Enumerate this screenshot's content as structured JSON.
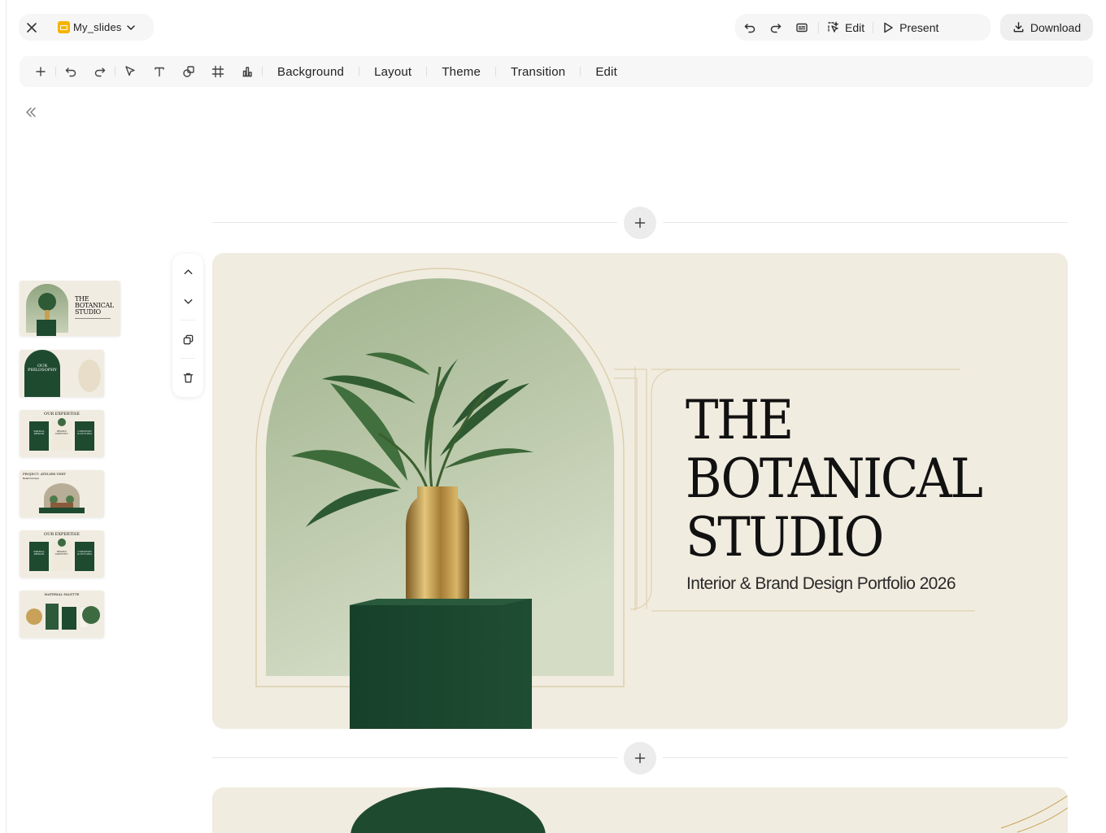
{
  "header": {
    "doc_name": "My_slides",
    "edit_label": "Edit",
    "present_label": "Present",
    "download_label": "Download",
    "accent": "#f5b400"
  },
  "toolbar": {
    "menus": [
      "Background",
      "Layout",
      "Theme",
      "Transition",
      "Edit"
    ]
  },
  "thumbnails": [
    {
      "title_lines": [
        "THE",
        "BOTANICAL",
        "STUDIO"
      ]
    },
    {
      "title_lines": [
        "OUR",
        "PHILOSOPHY"
      ]
    },
    {
      "title": "OUR EXPERTISE",
      "cards": [
        [
          "SPATIAL",
          "DESIGN"
        ],
        [
          "BRAND",
          "IDENTITY"
        ],
        [
          "CURATION",
          "& STYLING"
        ]
      ]
    },
    {
      "title": "PROJECT: ATELIER VERT",
      "subtitle": "Retail Concept"
    },
    {
      "title": "OUR EXPERTISE",
      "cards": [
        [
          "SPATIAL",
          "DESIGN"
        ],
        [
          "BRAND",
          "IDENTITY"
        ],
        [
          "CURATION",
          "& STYLING"
        ]
      ]
    },
    {
      "title": "MATERIAL PALETTE"
    }
  ],
  "slide": {
    "title_lines": [
      "THE",
      "BOTANICAL",
      "STUDIO"
    ],
    "subtitle": "Interior & Brand Design Portfolio 2026",
    "colors": {
      "background": "#f1ece0",
      "green": "#1e4a30",
      "gold": "#c9a25a",
      "arch": "#a9bc98"
    }
  }
}
